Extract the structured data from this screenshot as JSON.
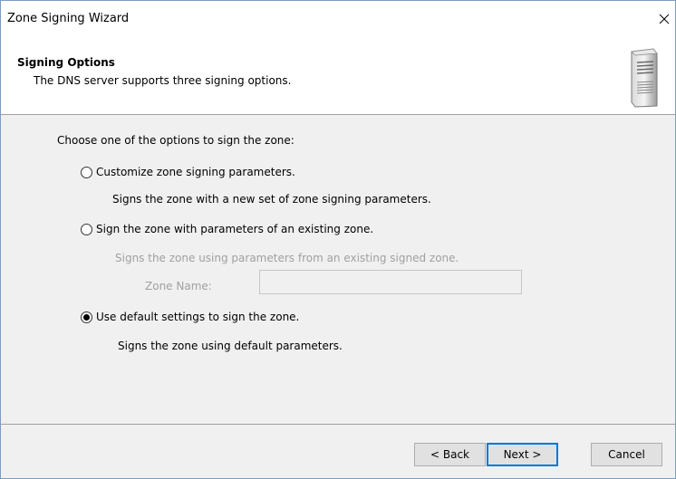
{
  "window": {
    "title": "Zone Signing Wizard"
  },
  "header": {
    "title": "Signing Options",
    "subtitle": "The DNS server supports three signing options."
  },
  "content": {
    "prompt": "Choose one of the options to sign the zone:",
    "options": [
      {
        "label": "Customize zone signing parameters.",
        "description": "Signs the zone with a new set of zone signing parameters.",
        "checked": false
      },
      {
        "label": "Sign the zone with parameters of an existing zone.",
        "description": "Signs the zone using parameters from an existing signed zone.",
        "checked": false
      },
      {
        "label": "Use default settings to sign the zone.",
        "description": "Signs the zone using default parameters.",
        "checked": true
      }
    ],
    "zone_name_label": "Zone Name:",
    "zone_name_value": ""
  },
  "buttons": {
    "back": "< Back",
    "next": "Next >",
    "cancel": "Cancel"
  },
  "colors": {
    "accent": "#0078d7",
    "disabled_text": "#a0a0a0"
  }
}
